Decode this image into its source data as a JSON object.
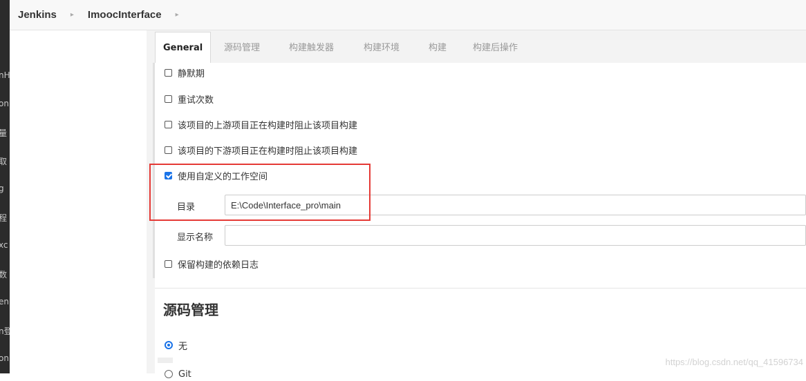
{
  "breadcrumb": {
    "root": "Jenkins",
    "project": "ImoocInterface"
  },
  "sidebar_fragments": [
    "nH",
    "on",
    "量",
    "取",
    "g",
    "程",
    "xc",
    "数",
    "en",
    "n登",
    "on"
  ],
  "tabs": [
    {
      "label": "General",
      "active": true
    },
    {
      "label": "源码管理",
      "active": false
    },
    {
      "label": "构建触发器",
      "active": false
    },
    {
      "label": "构建环境",
      "active": false
    },
    {
      "label": "构建",
      "active": false
    },
    {
      "label": "构建后操作",
      "active": false
    }
  ],
  "options": {
    "quiet_period": {
      "label": "静默期",
      "checked": false
    },
    "retry_count": {
      "label": "重试次数",
      "checked": false
    },
    "block_upstream": {
      "label": "该项目的上游项目正在构建时阻止该项目构建",
      "checked": false
    },
    "block_downstream": {
      "label": "该项目的下游项目正在构建时阻止该项目构建",
      "checked": false
    },
    "custom_workspace": {
      "label": "使用自定义的工作空间",
      "checked": true
    },
    "keep_dependencies": {
      "label": "保留构建的依赖日志",
      "checked": false
    }
  },
  "fields": {
    "directory": {
      "label": "目录",
      "value": "E:\\Code\\Interface_pro\\main"
    },
    "display_name": {
      "label": "显示名称",
      "value": ""
    }
  },
  "scm": {
    "title": "源码管理",
    "options": [
      {
        "label": "无",
        "selected": true
      },
      {
        "label": "Git",
        "selected": false
      }
    ]
  },
  "colors": {
    "accent": "#1a73e8",
    "highlight": "#e53935"
  },
  "watermark": "https://blog.csdn.net/qq_41596734"
}
